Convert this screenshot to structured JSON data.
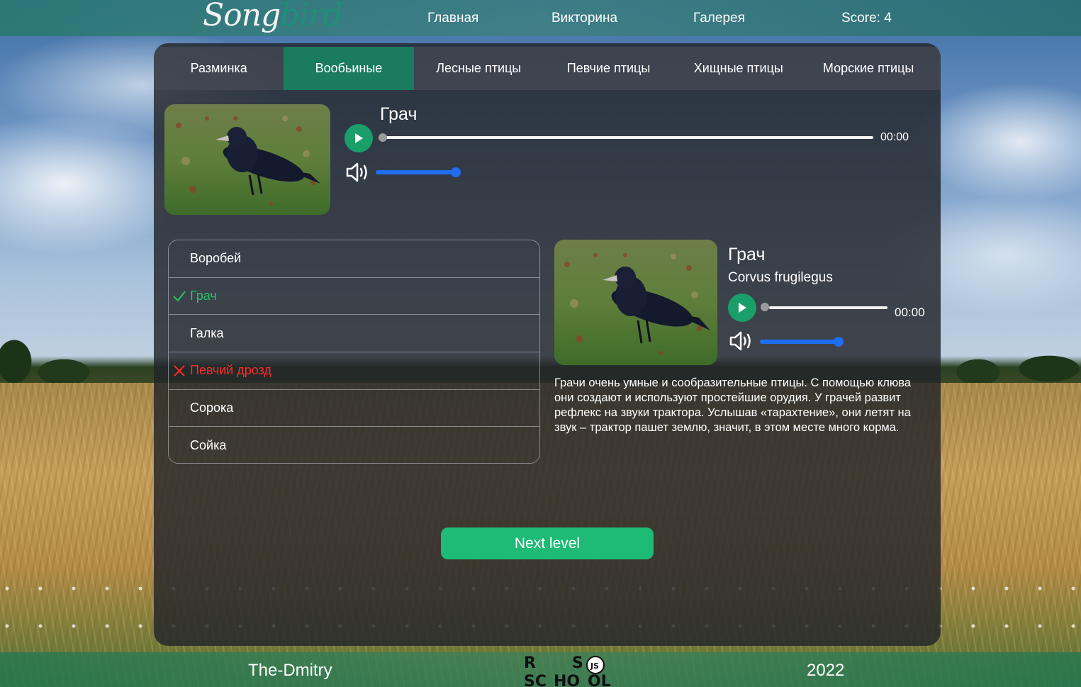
{
  "header": {
    "logo_part1": "Song",
    "logo_part2": "bird",
    "nav": [
      "Главная",
      "Викторина",
      "Галерея"
    ],
    "score": "Score: 4"
  },
  "tabs": [
    {
      "label": "Разминка",
      "active": false
    },
    {
      "label": "Вообьиные",
      "active": true
    },
    {
      "label": "Лесные птицы",
      "active": false
    },
    {
      "label": "Певчие птицы",
      "active": false
    },
    {
      "label": "Хищные птицы",
      "active": false
    },
    {
      "label": "Морские птицы",
      "active": false
    }
  ],
  "question": {
    "bird_name": "Грач",
    "time": "00:00",
    "progress": 0,
    "volume": 1.0
  },
  "answers": [
    {
      "label": "Воробей",
      "state": "none"
    },
    {
      "label": "Грач",
      "state": "correct"
    },
    {
      "label": "Галка",
      "state": "none"
    },
    {
      "label": "Певчий дрозд",
      "state": "wrong"
    },
    {
      "label": "Сорока",
      "state": "none"
    },
    {
      "label": "Сойка",
      "state": "none"
    }
  ],
  "details": {
    "name": "Грач",
    "latin": "Corvus frugilegus",
    "time": "00:00",
    "progress": 0,
    "volume": 1.0,
    "description": "Грачи очень умные и сообразительные птицы. С помощью клюва они создают и используют простейшие орудия. У грачей развит рефлекс на звуки трактора. Услышав «тарахтение», они летят на звук – трактор пашет землю, значит, в этом месте много корма."
  },
  "next_button": "Next level",
  "footer": {
    "author": "The-Dmitry",
    "year": "2022",
    "school_logo_letters": [
      "R",
      "S",
      "SC",
      "HO",
      "OL",
      "JS"
    ]
  },
  "colors": {
    "accent_green": "#1dbb75",
    "active_tab": "#1a7b5e",
    "correct": "#29c463",
    "wrong": "#ff2a2a",
    "volume_blue": "#1f6ef0"
  },
  "icons": {
    "play": "play-icon",
    "volume": "speaker-volume-icon",
    "check": "check-icon",
    "cross": "cross-icon"
  }
}
